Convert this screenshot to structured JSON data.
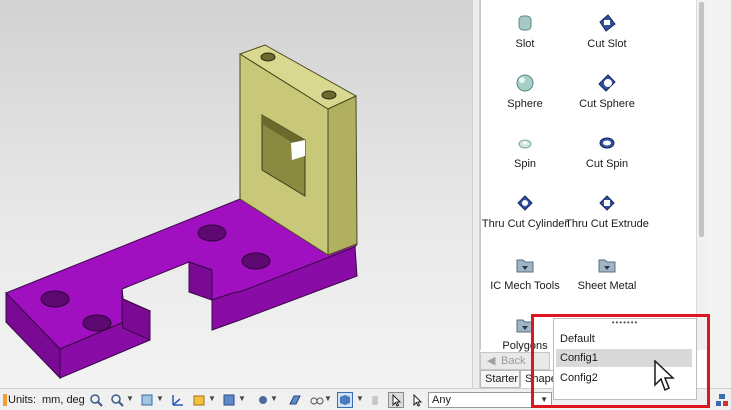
{
  "catalog": {
    "items": [
      {
        "label": "Slot",
        "icon": "slot-icon"
      },
      {
        "label": "Cut Slot",
        "icon": "cut-slot-icon"
      },
      {
        "label": "Sphere",
        "icon": "sphere-icon"
      },
      {
        "label": "Cut Sphere",
        "icon": "cut-sphere-icon"
      },
      {
        "label": "Spin",
        "icon": "spin-icon"
      },
      {
        "label": "Cut Spin",
        "icon": "cut-spin-icon"
      },
      {
        "label": "Thru Cut Cylinder",
        "icon": "thru-cut-cylinder-icon"
      },
      {
        "label": "Thru Cut Extrude",
        "icon": "thru-cut-extrude-icon"
      },
      {
        "label": "IC Mech Tools",
        "icon": "folder-icon"
      },
      {
        "label": "Sheet Metal",
        "icon": "folder-icon"
      },
      {
        "label": "Polygons",
        "icon": "folder-icon"
      }
    ]
  },
  "nav": {
    "back_label": "Back",
    "tabs": [
      {
        "label": "Starter",
        "active": false
      },
      {
        "label": "Shape",
        "active": true
      }
    ]
  },
  "config_popup": {
    "grip": "•••••••",
    "items": [
      {
        "label": "Default",
        "highlighted": false
      },
      {
        "label": "Config1",
        "highlighted": true
      },
      {
        "label": "Config2",
        "highlighted": false
      }
    ]
  },
  "toolbar": {
    "units_label": "Units:",
    "units_value": "mm, deg",
    "filter_value": "Any"
  },
  "colors": {
    "part_base": "#a010c0",
    "part_upright": "#c8c878",
    "annotation": "#e0141e"
  }
}
